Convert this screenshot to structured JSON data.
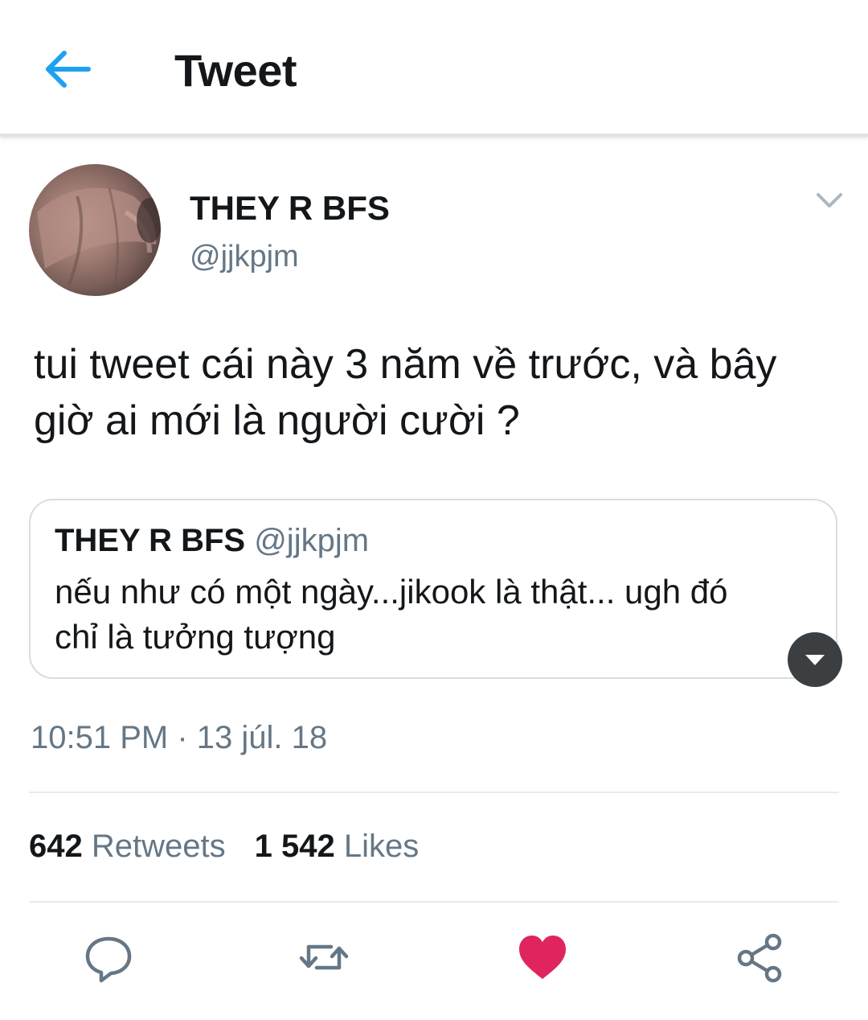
{
  "header": {
    "title": "Tweet",
    "back_icon": "arrow-left-icon"
  },
  "author": {
    "name": "THEY R BFS",
    "handle": "@jjkpjm"
  },
  "tweet": {
    "text_line1": "tui tweet cái này 3 năm về trước, và bây",
    "text_line2": "giờ ai mới là người cười ?"
  },
  "quote": {
    "name": "THEY R BFS",
    "handle": "@jjkpjm",
    "text_line1": "nếu như có một ngày...jikook là thật... ugh đó",
    "text_line2": "chỉ là tưởng tượng"
  },
  "timestamp": "10:51 PM · 13 júl. 18",
  "stats": {
    "retweets_count": "642",
    "retweets_label": "Retweets",
    "likes_count": "1 542",
    "likes_label": "Likes"
  },
  "colors": {
    "accent": "#1da1f2",
    "like": "#e0245e",
    "secondary_text": "#657786"
  },
  "actions": [
    "reply-icon",
    "retweet-icon",
    "like-icon",
    "share-icon"
  ]
}
